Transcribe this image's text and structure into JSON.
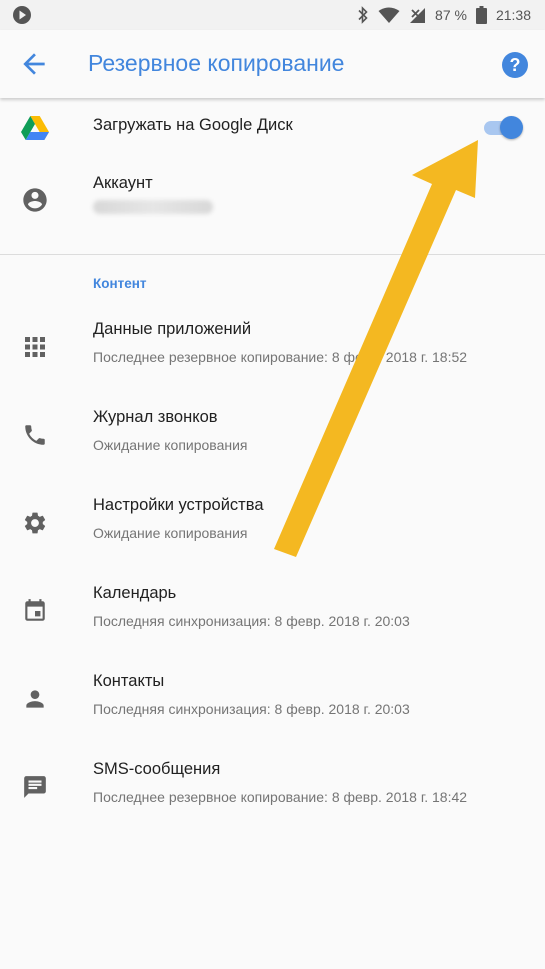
{
  "status_bar": {
    "battery_percent": "87 %",
    "time": "21:38",
    "icons": [
      "play-notification-icon",
      "bluetooth-icon",
      "wifi-icon",
      "signal-off-icon",
      "battery-icon"
    ]
  },
  "app_bar": {
    "title": "Резервное копирование",
    "back_icon": "arrow-back-icon",
    "help_icon": "help-icon"
  },
  "settings": {
    "drive": {
      "label": "Загружать на Google Диск",
      "enabled": true
    },
    "account": {
      "label": "Аккаунт"
    }
  },
  "content": {
    "header": "Контент",
    "items": [
      {
        "title": "Данные приложений",
        "subtitle": "Последнее резервное копирование: 8 февр. 2018 г. 18:52",
        "icon": "apps-grid-icon"
      },
      {
        "title": "Журнал звонков",
        "subtitle": "Ожидание копирования",
        "icon": "phone-icon"
      },
      {
        "title": "Настройки устройства",
        "subtitle": "Ожидание копирования",
        "icon": "gear-icon"
      },
      {
        "title": "Календарь",
        "subtitle": "Последняя синхронизация: 8 февр. 2018 г. 20:03",
        "icon": "calendar-icon"
      },
      {
        "title": "Контакты",
        "subtitle": "Последняя синхронизация: 8 февр. 2018 г. 20:03",
        "icon": "person-icon"
      },
      {
        "title": "SMS-сообщения",
        "subtitle": "Последнее резервное копирование: 8 февр. 2018 г. 18:42",
        "icon": "message-icon"
      }
    ]
  },
  "colors": {
    "accent": "#4286dd",
    "toggle_track": "#a9c7f0",
    "arrow": "#f4b821",
    "icon_gray": "#616161"
  }
}
